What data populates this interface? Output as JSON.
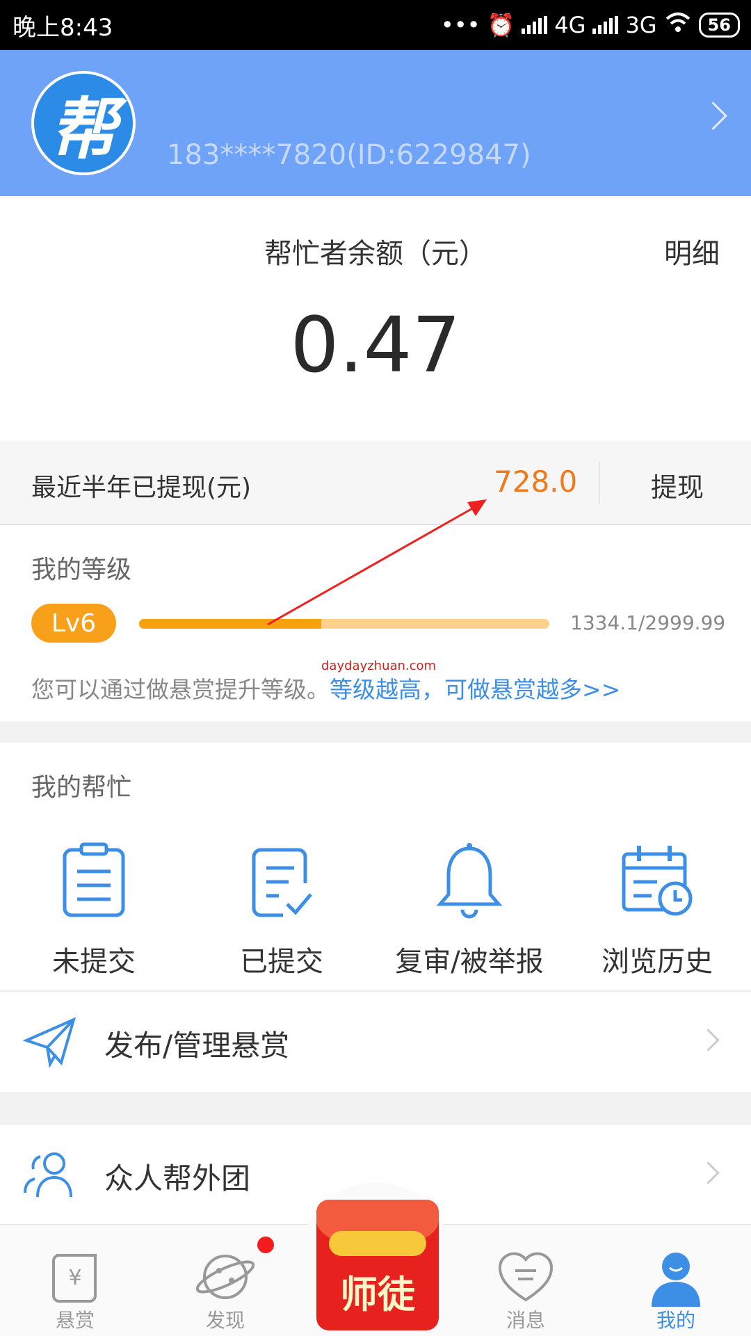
{
  "status_bar": {
    "time": "晚上8:43",
    "network_1": "4G",
    "network_2": "3G",
    "battery": "56"
  },
  "header": {
    "avatar_text": "帮",
    "user_id": "183****7820(ID:6229847)"
  },
  "balance": {
    "label": "帮忙者余额（元）",
    "detail_label": "明细",
    "value": "0.47"
  },
  "withdraw": {
    "label": "最近半年已提现(元)",
    "amount": "728.0",
    "button": "提现"
  },
  "level": {
    "title": "我的等级",
    "badge": "Lv6",
    "current": 1334.1,
    "target": 2999.99,
    "progress_text": "1334.1/2999.99",
    "tip": "您可以通过做悬赏提升等级。",
    "tip_link": "等级越高，可做悬赏越多>>",
    "watermark": "daydayzhuan.com"
  },
  "my_help": {
    "title": "我的帮忙",
    "items": [
      {
        "label": "未提交",
        "icon": "clipboard-icon"
      },
      {
        "label": "已提交",
        "icon": "checked-document-icon"
      },
      {
        "label": "复审/被举报",
        "icon": "bell-icon"
      },
      {
        "label": "浏览历史",
        "icon": "calendar-clock-icon"
      }
    ]
  },
  "menu": [
    {
      "label": "发布/管理悬赏",
      "icon": "paper-plane-icon"
    },
    {
      "label": "众人帮外团",
      "icon": "users-icon"
    }
  ],
  "bottom_nav": {
    "items": [
      {
        "label": "悬赏",
        "icon": "scroll-yuan-icon"
      },
      {
        "label": "发现",
        "icon": "planet-icon"
      },
      {
        "label": "师徒",
        "icon": "red-envelope-icon"
      },
      {
        "label": "消息",
        "icon": "chat-heart-icon"
      },
      {
        "label": "我的",
        "icon": "person-icon"
      }
    ]
  },
  "colors": {
    "header_bg": "#6fa3f8",
    "accent_orange": "#f07a1a",
    "icon_blue": "#3d8fe6",
    "level_bar": "#f7a10c"
  }
}
